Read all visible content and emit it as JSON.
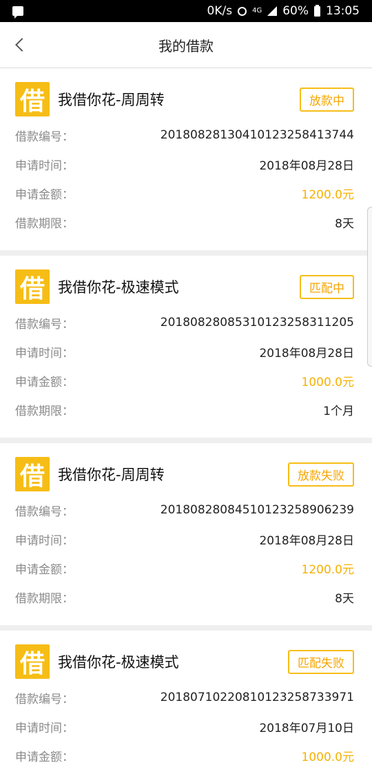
{
  "status_bar": {
    "speed": "0K/s",
    "network": "4G",
    "battery": "60%",
    "time": "13:05"
  },
  "nav": {
    "title": "我的借款"
  },
  "labels": {
    "loan_no": "借款编号：",
    "apply_time": "申请时间：",
    "apply_amount": "申请金额：",
    "term": "借款期限："
  },
  "loans": [
    {
      "logo": "借",
      "product": "我借你花-周周转",
      "status": "放款中",
      "loan_no": "20180828130410123258413744",
      "apply_time": "2018年08月28日",
      "amount": "1200.0元",
      "term": "8天"
    },
    {
      "logo": "借",
      "product": "我借你花-极速模式",
      "status": "匹配中",
      "loan_no": "20180828085310123258311205",
      "apply_time": "2018年08月28日",
      "amount": "1000.0元",
      "term": "1个月"
    },
    {
      "logo": "借",
      "product": "我借你花-周周转",
      "status": "放款失败",
      "loan_no": "20180828084510123258906239",
      "apply_time": "2018年08月28日",
      "amount": "1200.0元",
      "term": "8天"
    },
    {
      "logo": "借",
      "product": "我借你花-极速模式",
      "status": "匹配失败",
      "loan_no": "20180710220810123258733971",
      "apply_time": "2018年07月10日",
      "amount": "1000.0元"
    }
  ],
  "colors": {
    "accent": "#f6bd16",
    "amount": "#f6b100",
    "label": "#8a8a8a"
  }
}
